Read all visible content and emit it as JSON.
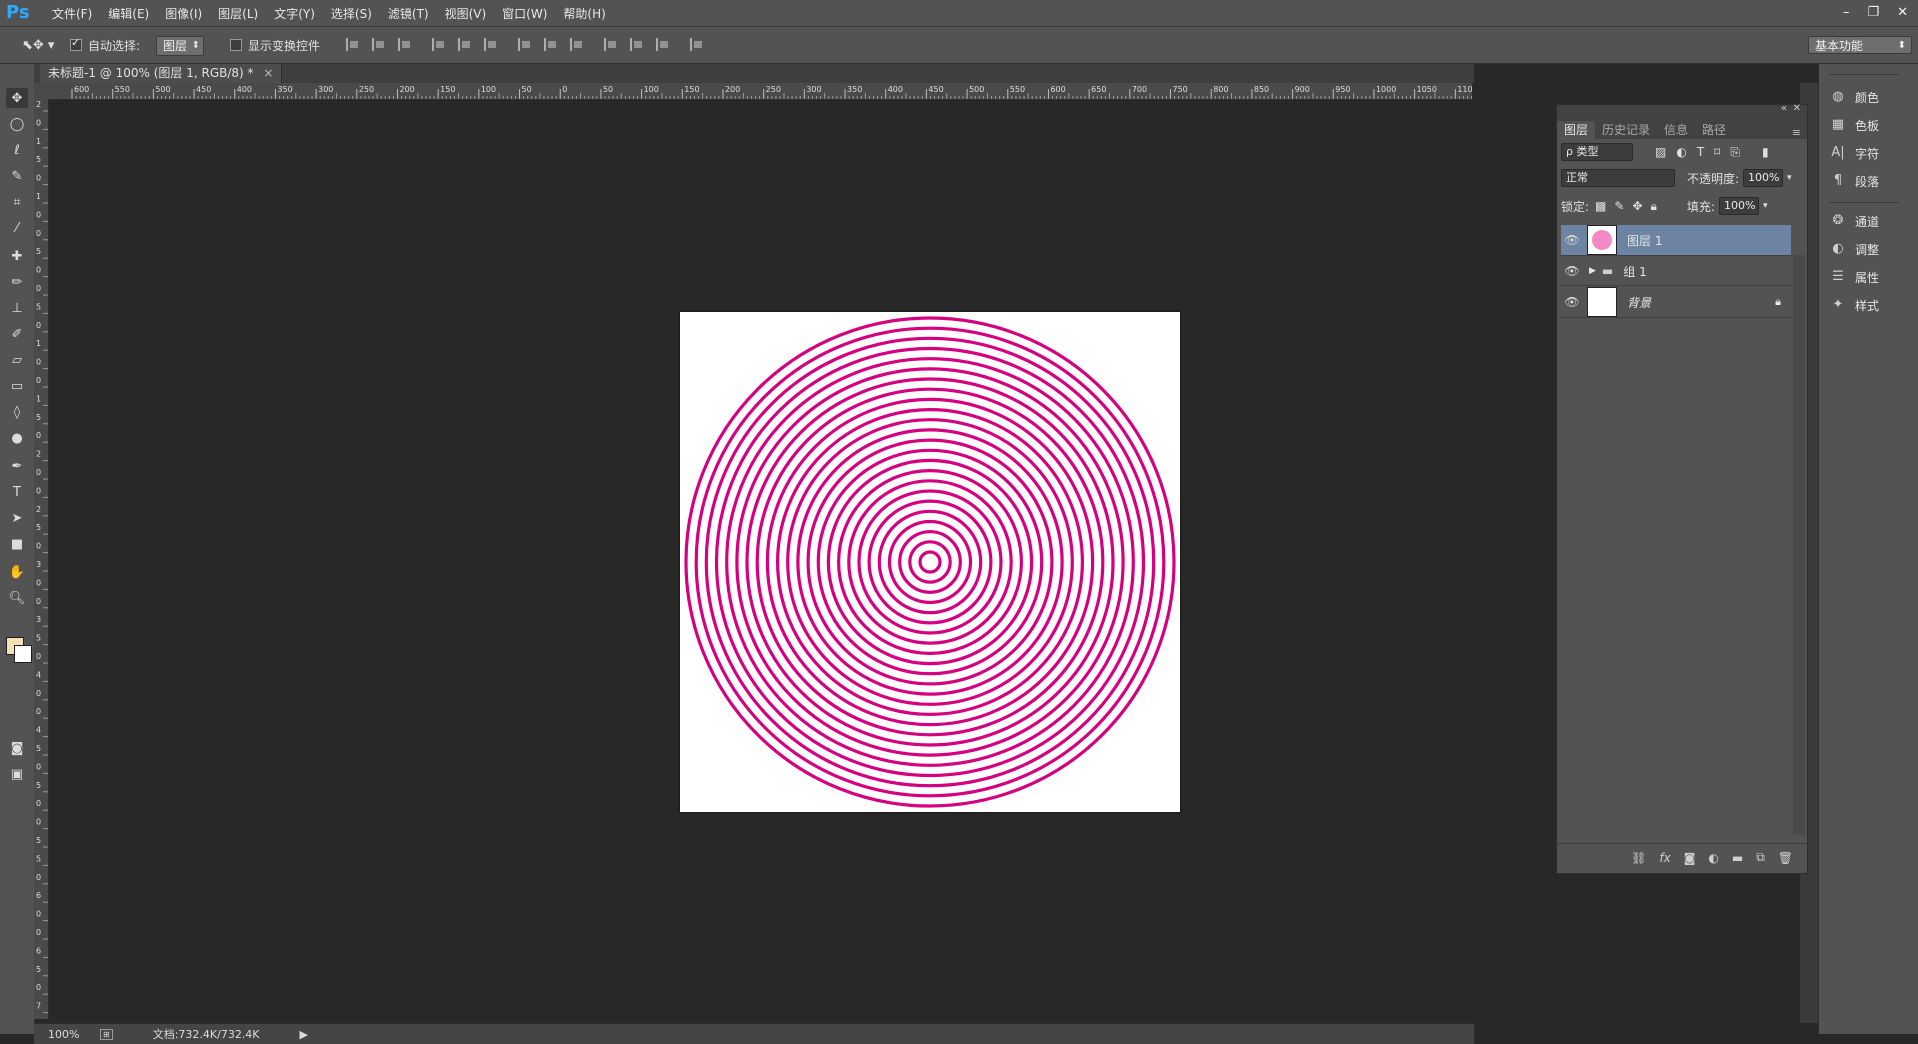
{
  "app": {
    "logo": "Ps",
    "menu": [
      "文件(F)",
      "编辑(E)",
      "图像(I)",
      "图层(L)",
      "文字(Y)",
      "选择(S)",
      "滤镜(T)",
      "视图(V)",
      "窗口(W)",
      "帮助(H)"
    ],
    "window_controls": [
      "–",
      "❐",
      "✕"
    ]
  },
  "options": {
    "auto_select_label": "自动选择:",
    "auto_select_checked": true,
    "auto_select_target": "图层",
    "show_transform_label": "显示变换控件",
    "show_transform_checked": false,
    "workspace": "基本功能"
  },
  "document": {
    "tab_title": "未标题-1 @ 100% (图层 1, RGB/8) *",
    "tab_close": "×",
    "zoom": "100%",
    "doc_size": "文档:732.4K/732.4K",
    "ring_color": "#d4007f",
    "ring_count": 24
  },
  "rulers": {
    "h_labels": [
      "600",
      "550",
      "500",
      "450",
      "400",
      "350",
      "300",
      "250",
      "200",
      "150",
      "100",
      "50",
      "0",
      "50",
      "100",
      "150",
      "200",
      "250",
      "300",
      "350",
      "400",
      "450",
      "500",
      "550",
      "600",
      "650",
      "700",
      "750",
      "800",
      "850",
      "900",
      "950",
      "1000",
      "1050",
      "110"
    ],
    "v_labels": [
      "2",
      "0",
      "1",
      "5",
      "0",
      "1",
      "0",
      "0",
      "5",
      "0",
      "0",
      "5",
      "0",
      "1",
      "0",
      "0",
      "1",
      "5",
      "0",
      "2",
      "0",
      "0",
      "2",
      "5",
      "0",
      "3",
      "0",
      "0",
      "3",
      "5",
      "0",
      "4",
      "0",
      "0",
      "4",
      "5",
      "0",
      "5",
      "0",
      "0",
      "5",
      "5",
      "0",
      "6",
      "0",
      "0",
      "6",
      "5",
      "0",
      "7"
    ]
  },
  "layers_panel": {
    "tabs": [
      "图层",
      "历史记录",
      "信息",
      "路径"
    ],
    "active_tab": "图层",
    "filter_label": "ρ 类型",
    "blend_mode": "正常",
    "opacity_label": "不透明度:",
    "opacity_value": "100%",
    "lock_label": "锁定:",
    "fill_label": "填充:",
    "fill_value": "100%",
    "layers": [
      {
        "name": "图层 1",
        "type": "pixel",
        "selected": true
      },
      {
        "name": "组 1",
        "type": "group",
        "selected": false
      },
      {
        "name": "背景",
        "type": "background",
        "selected": false,
        "locked": true
      }
    ]
  },
  "dock": {
    "group1": [
      "颜色",
      "色板",
      "字符",
      "段落"
    ],
    "group2": [
      "通道",
      "调整",
      "属性",
      "样式"
    ]
  }
}
